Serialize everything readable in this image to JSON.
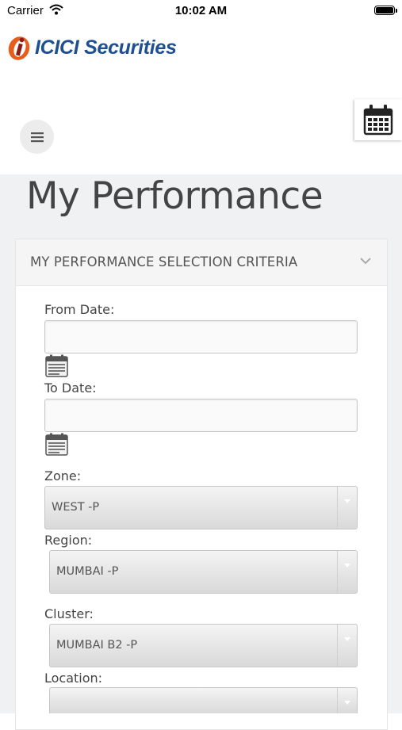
{
  "status": {
    "carrier": "Carrier",
    "time": "10:02 AM"
  },
  "brand": {
    "logo_text": "ICICI Securities"
  },
  "page": {
    "title": "My Performance"
  },
  "panel": {
    "title": "MY PERFORMANCE SELECTION CRITERIA"
  },
  "form": {
    "from_date": {
      "label": "From Date:",
      "value": ""
    },
    "to_date": {
      "label": "To Date:",
      "value": ""
    },
    "zone": {
      "label": "Zone:",
      "value": "WEST -P"
    },
    "region": {
      "label": "Region:",
      "value": "MUMBAI -P"
    },
    "cluster": {
      "label": "Cluster:",
      "value": "MUMBAI B2 -P"
    },
    "location": {
      "label": "Location:",
      "value": ""
    }
  },
  "colors": {
    "brand_blue": "#1d4f91",
    "brand_orange": "#e85d1c"
  }
}
